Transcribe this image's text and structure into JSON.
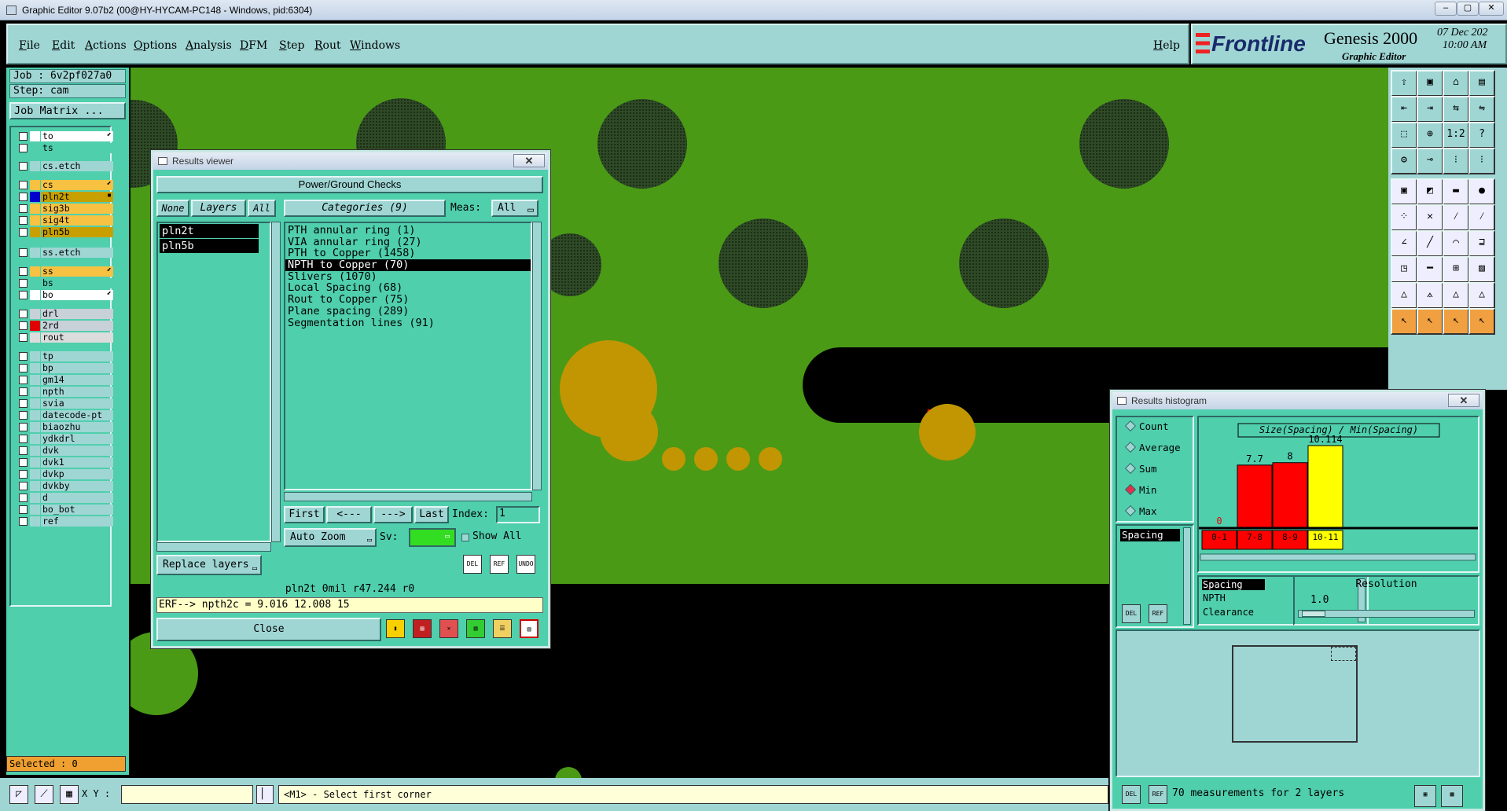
{
  "window": {
    "title": "Graphic Editor 9.07b2 (00@HY-HYCAM-PC148 - Windows, pid:6304)",
    "min": "‒",
    "max": "▢",
    "close": "✕"
  },
  "menu": {
    "items": [
      "File",
      "Edit",
      "Actions",
      "Options",
      "Analysis",
      "DFM",
      "Step",
      "Rout",
      "Windows"
    ],
    "help": "Help"
  },
  "brand": {
    "logo": "Frontline",
    "product": "Genesis 2000",
    "subtitle": "Graphic Editor",
    "date": "07 Dec 202",
    "time": "10:00 AM"
  },
  "job": {
    "job": "Job : 6v2pf027a0",
    "step": "Step: cam",
    "matrix": "Job Matrix ..."
  },
  "layers": [
    {
      "name": "to",
      "color": "#ffffff",
      "swatch": "#ffffff",
      "mark": "⬋"
    },
    {
      "name": "ts",
      "color": "#50cfad",
      "swatch": "#50cfad"
    },
    {
      "name": "cs.etch",
      "color": "#9fd6d4",
      "swatch": "#9fd6d4"
    },
    {
      "name": "cs",
      "color": "#f7c242",
      "swatch": "#f7c242",
      "mark": "⬋"
    },
    {
      "name": "pln2t",
      "color": "#c7a000",
      "swatch": "#0000cc",
      "mark": "▪"
    },
    {
      "name": "sig3b",
      "color": "#f7c242",
      "swatch": "#f7c242"
    },
    {
      "name": "sig4t",
      "color": "#f7c242",
      "swatch": "#f7c242"
    },
    {
      "name": "pln5b",
      "color": "#c7a000",
      "swatch": "#c7a000"
    },
    {
      "name": "ss.etch",
      "color": "#9fd6d4",
      "swatch": "#9fd6d4"
    },
    {
      "name": "ss",
      "color": "#f7c242",
      "swatch": "#f7c242",
      "mark": "⬋"
    },
    {
      "name": "bs",
      "color": "#50cfad",
      "swatch": "#50cfad"
    },
    {
      "name": "bo",
      "color": "#ffffff",
      "swatch": "#ffffff",
      "mark": "⬋"
    },
    {
      "name": "drl",
      "color": "#c8d0d8",
      "swatch": "#c8d0d8"
    },
    {
      "name": "2rd",
      "color": "#c8d0d8",
      "swatch": "#e00000"
    },
    {
      "name": "rout",
      "color": "#dcdcdc",
      "swatch": "#dcdcdc"
    },
    {
      "name": "tp",
      "color": "#9fd6d4",
      "swatch": "#9fd6d4"
    },
    {
      "name": "bp",
      "color": "#9fd6d4",
      "swatch": "#9fd6d4"
    },
    {
      "name": "gm14",
      "color": "#9fd6d4",
      "swatch": "#9fd6d4"
    },
    {
      "name": "npth",
      "color": "#9fd6d4",
      "swatch": "#9fd6d4"
    },
    {
      "name": "svia",
      "color": "#9fd6d4",
      "swatch": "#9fd6d4"
    },
    {
      "name": "datecode-pt",
      "color": "#9fd6d4",
      "swatch": "#9fd6d4"
    },
    {
      "name": "biaozhu",
      "color": "#9fd6d4",
      "swatch": "#9fd6d4"
    },
    {
      "name": "ydkdrl",
      "color": "#9fd6d4",
      "swatch": "#9fd6d4"
    },
    {
      "name": "dvk",
      "color": "#9fd6d4",
      "swatch": "#9fd6d4"
    },
    {
      "name": "dvk1",
      "color": "#9fd6d4",
      "swatch": "#9fd6d4"
    },
    {
      "name": "dvkp",
      "color": "#9fd6d4",
      "swatch": "#9fd6d4"
    },
    {
      "name": "dvkby",
      "color": "#9fd6d4",
      "swatch": "#9fd6d4"
    },
    {
      "name": "d",
      "color": "#9fd6d4",
      "swatch": "#9fd6d4"
    },
    {
      "name": "bo_bot",
      "color": "#9fd6d4",
      "swatch": "#9fd6d4"
    },
    {
      "name": "ref",
      "color": "#9fd6d4",
      "swatch": "#9fd6d4"
    }
  ],
  "selected": "Selected : 0",
  "results": {
    "title": "Results viewer",
    "header": "Power/Ground Checks",
    "none": "None",
    "layers_label": "Layers",
    "all": "All",
    "categories_label": "Categories (9)",
    "meas_label": "Meas:",
    "meas_value": "All",
    "layer_items": [
      "pln2t",
      "pln5b"
    ],
    "categories": [
      "PTH annular ring (1)",
      "VIA annular ring (27)",
      "PTH to Copper (1458)",
      "NPTH to Copper (70)",
      "Slivers (1070)",
      "Local Spacing (68)",
      "Rout to Copper (75)",
      "Plane spacing (289)",
      "Segmentation lines (91)"
    ],
    "selected_category": 3,
    "first": "First",
    "prev": "<---",
    "next": "--->",
    "last": "Last",
    "index_label": "Index:",
    "index_value": "1",
    "auto_zoom": "Auto Zoom",
    "sv": "Sv:",
    "show_all": "Show All",
    "replace_layers": "Replace layers",
    "info": "pln2t  0mil   r47.244   r0",
    "erf": "ERF--> npth2c = 9.016 12.008 15",
    "close": "Close",
    "del": "DEL",
    "ref": "REF",
    "undo": "UNDO"
  },
  "histogram": {
    "title": "Results histogram",
    "modes": [
      "Count",
      "Average",
      "Sum",
      "Min",
      "Max"
    ],
    "active_mode": 3,
    "list_item": "Spacing",
    "chart_title": "Size(Spacing) / Min(Spacing)",
    "resolution_label": "Resolution",
    "resolution_value": "1.0",
    "legend": [
      "Spacing",
      "NPTH",
      "Clearance"
    ],
    "status": "70 measurements for 2 layers",
    "del": "DEL",
    "ref": "REF"
  },
  "chart_data": {
    "type": "bar",
    "title": "Size(Spacing) / Min(Spacing)",
    "categories": [
      "0-1",
      "7-8",
      "8-9",
      "10-11"
    ],
    "values": [
      0,
      7.7,
      8,
      10.114
    ],
    "value_labels": [
      "0",
      "7.7",
      "8",
      "10.114"
    ],
    "colors": [
      "#ff0000",
      "#ff0000",
      "#ff0000",
      "#ffff00"
    ]
  },
  "statusbar": {
    "xy_label": "X Y :",
    "xy_value": "",
    "prompt": "<M1> - Select first corner"
  }
}
